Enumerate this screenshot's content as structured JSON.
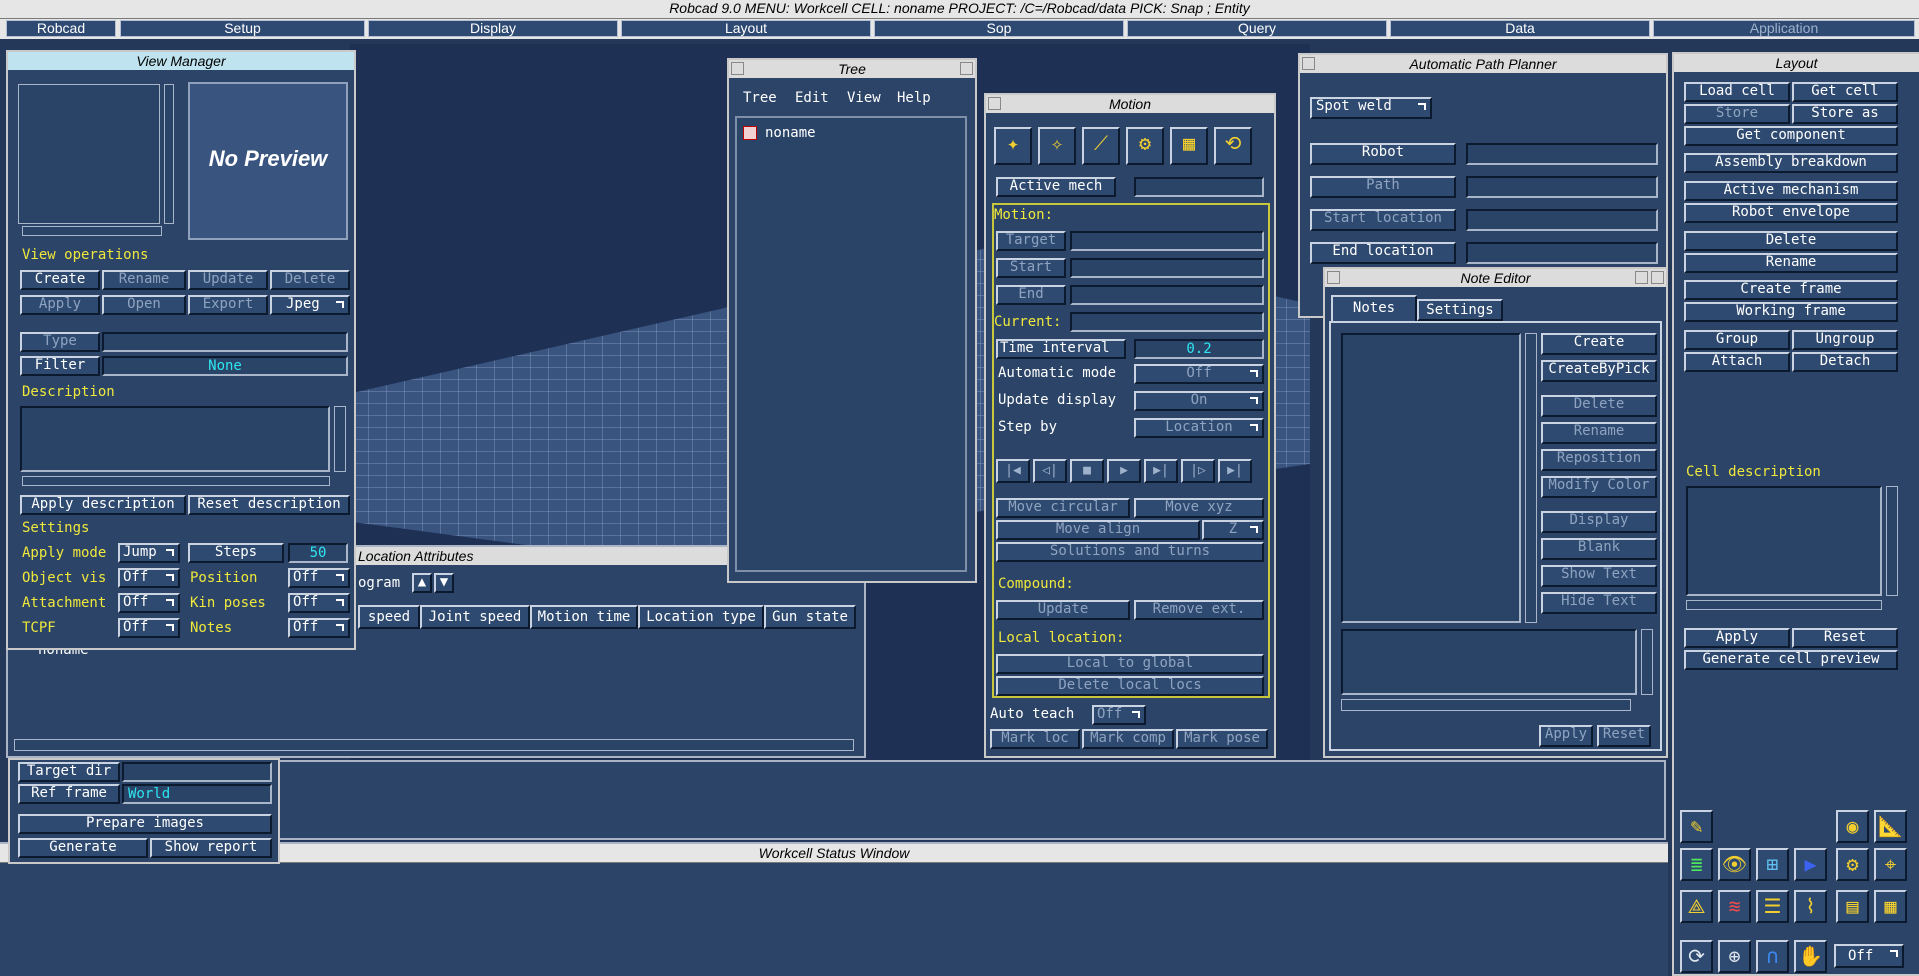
{
  "top_title": "Robcad 9.0      MENU: Workcell      CELL: noname      PROJECT: /C=/Robcad/data           PICK: Snap ; Entity",
  "menubar": {
    "robcad": "Robcad",
    "setup": "Setup",
    "display": "Display",
    "layout": "Layout",
    "sop": "Sop",
    "query": "Query",
    "data": "Data",
    "application": "Application"
  },
  "view_manager": {
    "title": "View Manager",
    "preview": "No Preview",
    "view_operations": "View operations",
    "create": "Create",
    "rename": "Rename",
    "update": "Update",
    "delete": "Delete",
    "apply": "Apply",
    "open": "Open",
    "export": "Export",
    "format": "Jpeg",
    "type_label": "Type",
    "filter_label": "Filter",
    "filter_value": "None",
    "description_label": "Description",
    "apply_description": "Apply description",
    "reset_description": "Reset description",
    "settings": "Settings",
    "apply_mode_label": "Apply mode",
    "apply_mode": "Jump",
    "steps_label": "Steps",
    "steps": "50",
    "object_vis_label": "Object vis",
    "object_vis": "Off",
    "position_label": "Position",
    "position": "Off",
    "attachment_label": "Attachment",
    "attachment": "Off",
    "kin_poses_label": "Kin poses",
    "kin_poses": "Off",
    "tcpf_label": "TCPF",
    "tcpf": "Off",
    "notes_label": "Notes",
    "notes": "Off"
  },
  "tree": {
    "title": "Tree",
    "menu": {
      "tree": "Tree",
      "edit": "Edit",
      "view": "View",
      "help": "Help"
    },
    "node": "noname"
  },
  "location_attributes": {
    "title": "Location Attributes",
    "program_label": "ogram",
    "columns": [
      "speed",
      "Joint speed",
      "Motion time",
      "Location type",
      "Gun state"
    ],
    "row": "noname"
  },
  "motion": {
    "title": "Motion",
    "active_mech": "Active mech",
    "motion_label": "Motion:",
    "target": "Target",
    "start": "Start",
    "end": "End",
    "current_label": "Current:",
    "time_interval_label": "Time interval",
    "time_interval": "0.2",
    "automatic_mode_label": "Automatic mode",
    "automatic_mode": "Off",
    "update_display_label": "Update display",
    "update_display": "On",
    "step_by_label": "Step by",
    "step_by": "Location",
    "move_circular": "Move circular",
    "move_xyz": "Move xyz",
    "move_align": "Move align",
    "axis": "Z",
    "solutions_and_turns": "Solutions and turns",
    "compound_label": "Compound:",
    "update": "Update",
    "remove_ext": "Remove ext.",
    "local_location_label": "Local location:",
    "local_to_global": "Local to global",
    "delete_local_locs": "Delete local locs",
    "auto_teach_label": "Auto teach",
    "auto_teach": "Off",
    "mark_loc": "Mark loc",
    "mark_comp": "Mark comp",
    "mark_pose": "Mark pose"
  },
  "path_planner": {
    "title": "Automatic Path Planner",
    "mode": "Spot weld",
    "robot": "Robot",
    "path": "Path",
    "start_location": "Start location",
    "end_location": "End location"
  },
  "note_editor": {
    "title": "Note Editor",
    "tab_notes": "Notes",
    "tab_settings": "Settings",
    "create": "Create",
    "create_by_pick": "CreateByPick",
    "delete": "Delete",
    "rename": "Rename",
    "reposition": "Reposition",
    "modify_color": "Modify Color",
    "display": "Display",
    "blank": "Blank",
    "show_text": "Show Text",
    "hide_text": "Hide Text",
    "apply": "Apply",
    "reset": "Reset"
  },
  "layout_panel": {
    "title": "Layout",
    "load_cell": "Load cell",
    "get_cell": "Get cell",
    "store": "Store",
    "store_as": "Store as",
    "get_component": "Get component",
    "assembly_breakdown": "Assembly breakdown",
    "active_mechanism": "Active mechanism",
    "robot_envelope": "Robot envelope",
    "delete": "Delete",
    "rename": "Rename",
    "create_frame": "Create frame",
    "working_frame": "Working frame",
    "group": "Group",
    "ungroup": "Ungroup",
    "attach": "Attach",
    "detach": "Detach",
    "cell_description": "Cell description",
    "apply": "Apply",
    "reset": "Reset",
    "generate_cell_preview": "Generate cell preview",
    "toggle": "Off"
  },
  "images_panel": {
    "target_dir_label": "Target dir",
    "ref_frame_label": "Ref frame",
    "ref_frame": "World",
    "prepare_images": "Prepare images",
    "generate": "Generate",
    "show_report": "Show report"
  },
  "status_window": {
    "title": "Workcell Status Window"
  }
}
